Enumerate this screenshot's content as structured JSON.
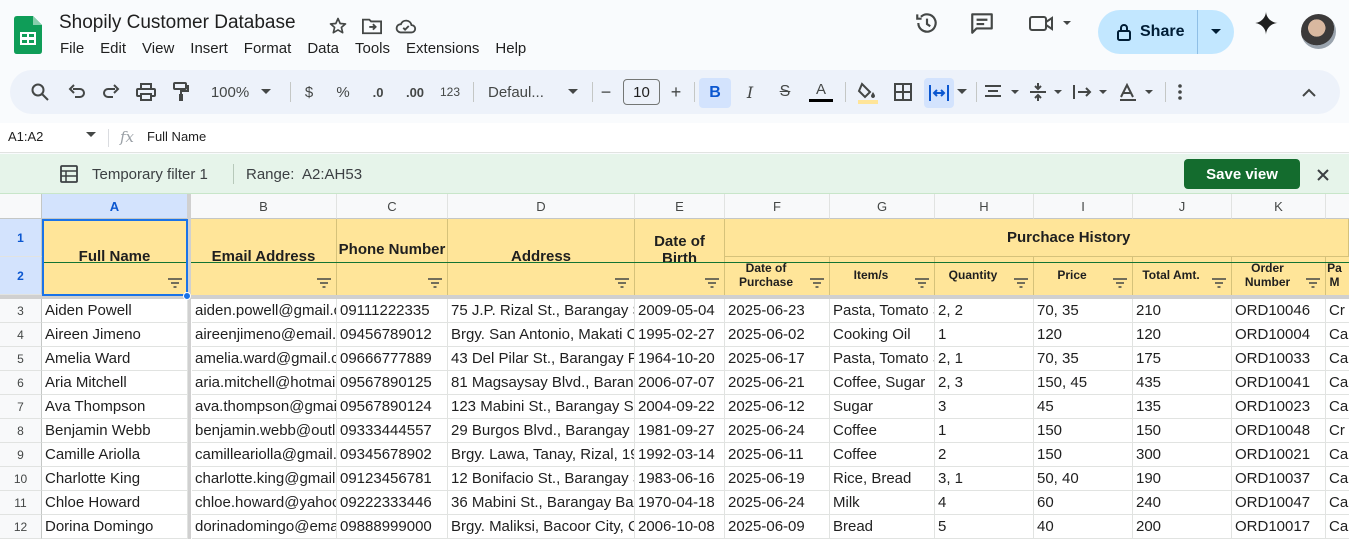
{
  "app": {
    "title": "Shopily Customer Database",
    "menus": [
      "File",
      "Edit",
      "View",
      "Insert",
      "Format",
      "Data",
      "Tools",
      "Extensions",
      "Help"
    ],
    "share_label": "Share"
  },
  "toolbar": {
    "zoom": "100%",
    "currency": "$",
    "percent": "%",
    "dec_decrease": ".0",
    "dec_increase": ".00",
    "number_format": "123",
    "font": "Defaul...",
    "font_size": "10",
    "minus": "−",
    "plus": "+",
    "bold": "B",
    "italic": "I",
    "strike": "S",
    "text_color_letter": "A",
    "accent": "#0b57d0"
  },
  "formula_bar": {
    "name_box": "A1:A2",
    "fx": "fx",
    "content": "Full Name"
  },
  "filter_bar": {
    "filter_name": "Temporary filter 1",
    "range_label": "Range:",
    "range_value": "A2:AH53",
    "save_view_label": "Save view"
  },
  "columns": [
    "A",
    "B",
    "C",
    "D",
    "E",
    "F",
    "G",
    "H",
    "I",
    "J",
    "K"
  ],
  "row_numbers": [
    "1",
    "2",
    "3",
    "4",
    "5",
    "6",
    "7",
    "8",
    "9",
    "10",
    "11",
    "12"
  ],
  "headers": {
    "full_name": "Full Name",
    "email": "Email Address",
    "phone": "Phone Number",
    "address": "Address",
    "dob": "Date of Birth",
    "purchase_history": "Purchace History",
    "date_of_purchase": "Date of Purchase",
    "items": "Item/s",
    "quantity": "Quantity",
    "price": "Price",
    "total": "Total Amt.",
    "order_number": "Order Number",
    "partial": "Pa M"
  },
  "rows": [
    [
      "Aiden Powell",
      "aiden.powell@gmail.c",
      "09111222335",
      "75 J.P. Rizal St., Barangay S",
      "2009-05-04",
      "2025-06-23",
      "Pasta, Tomato S",
      "2, 2",
      "70, 35",
      "210",
      "ORD10046",
      "Cr"
    ],
    [
      "Aireen Jimeno",
      "aireenjimeno@email.",
      "09456789012",
      "Brgy. San Antonio, Makati C",
      "1995-02-27",
      "2025-06-02",
      "Cooking Oil",
      "1",
      "120",
      "120",
      "ORD10004",
      "Ca"
    ],
    [
      "Amelia Ward",
      "amelia.ward@gmail.c",
      "09666777889",
      "43 Del Pilar St., Barangay P",
      "1964-10-20",
      "2025-06-17",
      "Pasta, Tomato S",
      "2, 1",
      "70, 35",
      "175",
      "ORD10033",
      "Ca"
    ],
    [
      "Aria Mitchell",
      "aria.mitchell@hotmail",
      "09567890125",
      "81 Magsaysay Blvd., Barang",
      "2006-07-07",
      "2025-06-21",
      "Coffee, Sugar",
      "2, 3",
      "150, 45",
      "435",
      "ORD10041",
      "Ca"
    ],
    [
      "Ava Thompson",
      "ava.thompson@gmai",
      "09567890124",
      "123 Mabini St., Barangay Sa",
      "2004-09-22",
      "2025-06-12",
      "Sugar",
      "3",
      "45",
      "135",
      "ORD10023",
      "Ca"
    ],
    [
      "Benjamin Webb",
      "benjamin.webb@outl",
      "09333444557",
      "29 Burgos Blvd., Barangay S",
      "1981-09-27",
      "2025-06-24",
      "Coffee",
      "1",
      "150",
      "150",
      "ORD10048",
      "Cr"
    ],
    [
      "Camille Ariolla",
      "camilleariolla@gmail.",
      "09345678902",
      "Brgy. Lawa, Tanay, Rizal, 19",
      "1992-03-14",
      "2025-06-11",
      "Coffee",
      "2",
      "150",
      "300",
      "ORD10021",
      "Ca"
    ],
    [
      "Charlotte King",
      "charlotte.king@gmail.",
      "09123456781",
      "12 Bonifacio St., Barangay S",
      "1983-06-16",
      "2025-06-19",
      "Rice, Bread",
      "3, 1",
      "50, 40",
      "190",
      "ORD10037",
      "Ca"
    ],
    [
      "Chloe Howard",
      "chloe.howard@yahoo",
      "09222333446",
      "36 Mabini St., Barangay Bag",
      "1970-04-18",
      "2025-06-24",
      "Milk",
      "4",
      "60",
      "240",
      "ORD10047",
      "Ca"
    ],
    [
      "Dorina Domingo",
      "dorinadomingo@ema",
      "09888999000",
      "Brgy. Maliksi, Bacoor City, C",
      "2006-10-08",
      "2025-06-09",
      "Bread",
      "5",
      "40",
      "200",
      "ORD10017",
      "Ca"
    ]
  ]
}
